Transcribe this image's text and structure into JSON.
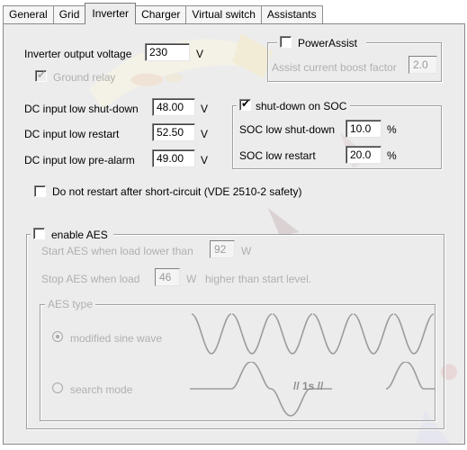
{
  "tabs": [
    "General",
    "Grid",
    "Inverter",
    "Charger",
    "Virtual switch",
    "Assistants"
  ],
  "active_tab": "Inverter",
  "inverter_output_voltage": {
    "label": "Inverter output voltage",
    "value": "230",
    "unit": "V"
  },
  "ground_relay": {
    "label": "Ground relay",
    "checked": true,
    "enabled": false
  },
  "power_assist": {
    "label": "PowerAssist",
    "checked": false,
    "boost_label": "Assist current boost factor",
    "boost_value": "2.0"
  },
  "dc_low_shutdown": {
    "label": "DC input low shut-down",
    "value": "48.00",
    "unit": "V"
  },
  "dc_low_restart": {
    "label": "DC input low restart",
    "value": "52.50",
    "unit": "V"
  },
  "dc_low_prealarm": {
    "label": "DC input low pre-alarm",
    "value": "49.00",
    "unit": "V"
  },
  "shutdown_on_soc": {
    "label": "shut-down on SOC",
    "checked": true,
    "soc_low_shutdown": {
      "label": "SOC low shut-down",
      "value": "10.0",
      "unit": "%"
    },
    "soc_low_restart": {
      "label": "SOC low restart",
      "value": "20.0",
      "unit": "%"
    }
  },
  "no_restart_short": {
    "label": "Do not restart after short-circuit (VDE 2510-2  safety)",
    "checked": false
  },
  "aes": {
    "label": "enable AES",
    "checked": false,
    "start_label": "Start AES when load lower than",
    "start_value": "92",
    "start_unit": "W",
    "stop_label": "Stop AES when load",
    "stop_value": "46",
    "stop_unit": "W",
    "stop_suffix": "higher than start level.",
    "type_label": "AES type",
    "modified_sine": "modified sine wave",
    "search_mode": "search mode",
    "search_gap_label": "// 1s //",
    "selected": "modified sine wave"
  },
  "colors": {
    "panel": "#ececec",
    "disabled_text": "#b0b0b0",
    "border": "#8a8a8a"
  }
}
